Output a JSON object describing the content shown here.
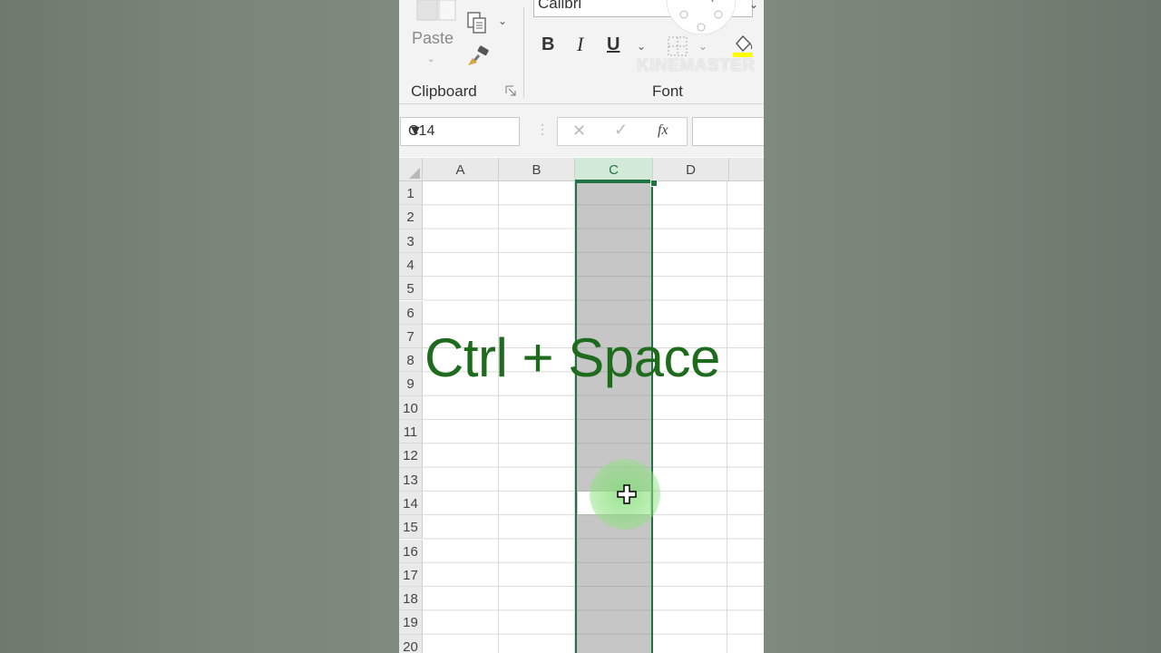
{
  "ribbon": {
    "paste_label": "Paste",
    "clipboard_label": "Clipboard",
    "font_label": "Font",
    "font_name": "Calibri",
    "bold": "B",
    "italic": "I",
    "underline": "U",
    "watermark": "KINEMASTER"
  },
  "formula_bar": {
    "name_box": "C14",
    "fx": "fx",
    "value": ""
  },
  "grid": {
    "columns": [
      "A",
      "B",
      "C",
      "D"
    ],
    "rows": [
      "1",
      "2",
      "3",
      "4",
      "5",
      "6",
      "7",
      "8",
      "9",
      "10",
      "11",
      "12",
      "13",
      "14",
      "15",
      "16",
      "17",
      "18",
      "19",
      "20"
    ],
    "selected_column": "C",
    "active_cell": "C14"
  },
  "overlay": {
    "shortcut_text": "Ctrl + Space"
  },
  "colors": {
    "accent": "#217346",
    "overlay_text": "#1e6b1e",
    "selection": "#c6c6c6"
  }
}
